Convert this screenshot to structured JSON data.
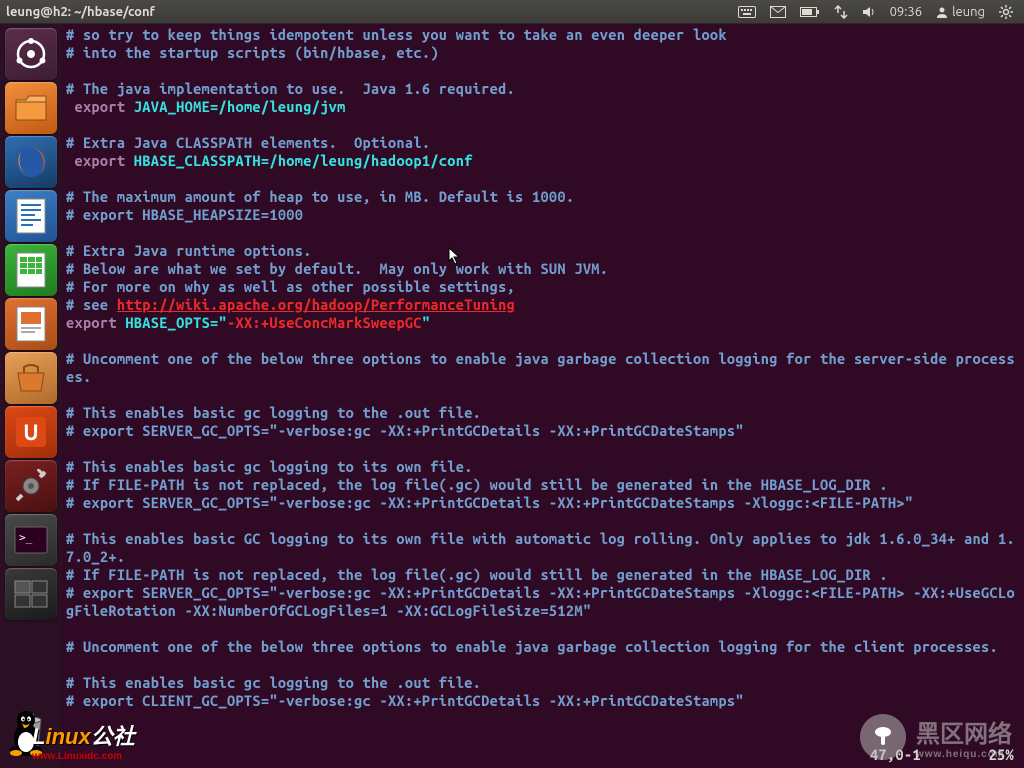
{
  "topbar": {
    "title": "leung@h2: ~/hbase/conf",
    "time": "09:36",
    "user": "leung"
  },
  "launcher": [
    {
      "name": "dash",
      "color1": "#5a2d4c",
      "color2": "#3c1d33"
    },
    {
      "name": "files",
      "color1": "#f28f3b",
      "color2": "#c05a14"
    },
    {
      "name": "firefox",
      "color1": "#2f6fb3",
      "color2": "#163b66"
    },
    {
      "name": "writer",
      "color1": "#3d7fc7",
      "color2": "#205393"
    },
    {
      "name": "calc",
      "color1": "#3cb53c",
      "color2": "#1f7a1f"
    },
    {
      "name": "impress",
      "color1": "#e07030",
      "color2": "#a94d17"
    },
    {
      "name": "software",
      "color1": "#e8a05a",
      "color2": "#b06a28"
    },
    {
      "name": "ubuntu-one",
      "color1": "#dd4814",
      "color2": "#a02f0b"
    },
    {
      "name": "settings",
      "color1": "#7a2020",
      "color2": "#4a1010"
    },
    {
      "name": "terminal",
      "color1": "#4a4a4a",
      "color2": "#2a2a2a"
    },
    {
      "name": "workspaces",
      "color1": "#3a3a3a",
      "color2": "#1a1a1a"
    }
  ],
  "editor": {
    "lines": [
      {
        "t": "comment",
        "text": "# so try to keep things idempotent unless you want to take an even deeper look"
      },
      {
        "t": "comment",
        "text": "# into the startup scripts (bin/hbase, etc.)"
      },
      {
        "t": "blank",
        "text": ""
      },
      {
        "t": "comment",
        "text": "# The java implementation to use.  Java 1.6 required."
      },
      {
        "t": "export1",
        "pre": " ",
        "kw": "export",
        "var": " JAVA_HOME=/home/leung/jvm"
      },
      {
        "t": "blank",
        "text": ""
      },
      {
        "t": "comment",
        "text": "# Extra Java CLASSPATH elements.  Optional."
      },
      {
        "t": "export1",
        "pre": " ",
        "kw": "export",
        "var": " HBASE_CLASSPATH=/home/leung/hadoop1/conf"
      },
      {
        "t": "blank",
        "text": ""
      },
      {
        "t": "comment",
        "text": "# The maximum amount of heap to use, in MB. Default is 1000."
      },
      {
        "t": "comment",
        "text": "# export HBASE_HEAPSIZE=1000"
      },
      {
        "t": "blank",
        "text": ""
      },
      {
        "t": "comment",
        "text": "# Extra Java runtime options."
      },
      {
        "t": "comment",
        "text": "# Below are what we set by default.  May only work with SUN JVM."
      },
      {
        "t": "comment",
        "text": "# For more on why as well as other possible settings,"
      },
      {
        "t": "commenturl",
        "pre": "# see ",
        "url": "http://wiki.apache.org/hadoop/PerformanceTuning"
      },
      {
        "t": "export2",
        "kw": "export",
        "var": " HBASE_OPTS=",
        "q1": "\"",
        "str": "-XX:+UseConcMarkSweepGC",
        "q2": "\""
      },
      {
        "t": "blank",
        "text": ""
      },
      {
        "t": "comment",
        "text": "# Uncomment one of the below three options to enable java garbage collection logging for the server-side processes."
      },
      {
        "t": "blank",
        "text": ""
      },
      {
        "t": "comment",
        "text": "# This enables basic gc logging to the .out file."
      },
      {
        "t": "comment",
        "text": "# export SERVER_GC_OPTS=\"-verbose:gc -XX:+PrintGCDetails -XX:+PrintGCDateStamps\""
      },
      {
        "t": "blank",
        "text": ""
      },
      {
        "t": "comment",
        "text": "# This enables basic gc logging to its own file."
      },
      {
        "t": "comment",
        "text": "# If FILE-PATH is not replaced, the log file(.gc) would still be generated in the HBASE_LOG_DIR ."
      },
      {
        "t": "comment",
        "text": "# export SERVER_GC_OPTS=\"-verbose:gc -XX:+PrintGCDetails -XX:+PrintGCDateStamps -Xloggc:<FILE-PATH>\""
      },
      {
        "t": "blank",
        "text": ""
      },
      {
        "t": "comment",
        "text": "# This enables basic GC logging to its own file with automatic log rolling. Only applies to jdk 1.6.0_34+ and 1.7.0_2+."
      },
      {
        "t": "comment",
        "text": "# If FILE-PATH is not replaced, the log file(.gc) would still be generated in the HBASE_LOG_DIR ."
      },
      {
        "t": "comment",
        "text": "# export SERVER_GC_OPTS=\"-verbose:gc -XX:+PrintGCDetails -XX:+PrintGCDateStamps -Xloggc:<FILE-PATH> -XX:+UseGCLogFileRotation -XX:NumberOfGCLogFiles=1 -XX:GCLogFileSize=512M\""
      },
      {
        "t": "blank",
        "text": ""
      },
      {
        "t": "comment",
        "text": "# Uncomment one of the below three options to enable java garbage collection logging for the client processes."
      },
      {
        "t": "blank",
        "text": ""
      },
      {
        "t": "comment",
        "text": "# This enables basic gc logging to the .out file."
      },
      {
        "t": "comment",
        "text": "# export CLIENT_GC_OPTS=\"-verbose:gc -XX:+PrintGCDetails -XX:+PrintGCDateStamps\""
      }
    ],
    "status": "47,0-1        25%"
  },
  "watermark1": {
    "text": "黑区网络",
    "sub": "www.heiqu.com"
  },
  "watermark2": {
    "text1": "L",
    "text2": "inux",
    "text3": "公社",
    "url": "www.Linuxidc.com"
  }
}
